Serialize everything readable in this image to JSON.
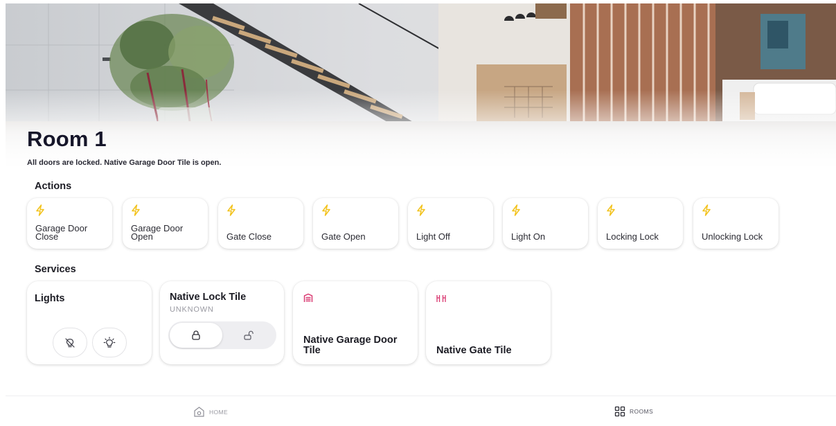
{
  "room": {
    "title": "Room 1",
    "status": "All doors are locked. Native Garage Door Tile is open."
  },
  "sections": {
    "actions": "Actions",
    "services": "Services"
  },
  "actions": [
    {
      "label": "Garage Door Close",
      "icon": "bolt-icon"
    },
    {
      "label": "Garage Door Open",
      "icon": "bolt-icon"
    },
    {
      "label": "Gate Close",
      "icon": "bolt-icon"
    },
    {
      "label": "Gate Open",
      "icon": "bolt-icon"
    },
    {
      "label": "Light Off",
      "icon": "bolt-icon"
    },
    {
      "label": "Light On",
      "icon": "bolt-icon"
    },
    {
      "label": "Locking Lock",
      "icon": "bolt-icon"
    },
    {
      "label": "Unlocking Lock",
      "icon": "bolt-icon"
    }
  ],
  "services": {
    "lights": {
      "title": "Lights",
      "buttons": [
        "light-off-icon",
        "light-on-icon"
      ]
    },
    "lock": {
      "title": "Native Lock Tile",
      "state": "UNKNOWN",
      "options": [
        "lock-icon",
        "unlock-icon"
      ]
    },
    "garage": {
      "title": "Native Garage Door Tile",
      "icon": "garage-icon"
    },
    "gate": {
      "title": "Native Gate Tile",
      "icon": "gate-icon"
    }
  },
  "nav": {
    "home": {
      "label": "HOME",
      "icon": "home-icon"
    },
    "rooms": {
      "label": "ROOMS",
      "icon": "grid-icon"
    }
  },
  "colors": {
    "action_icon": "#f2c21b",
    "service_icon": "#d8336d",
    "title": "#16162a"
  }
}
